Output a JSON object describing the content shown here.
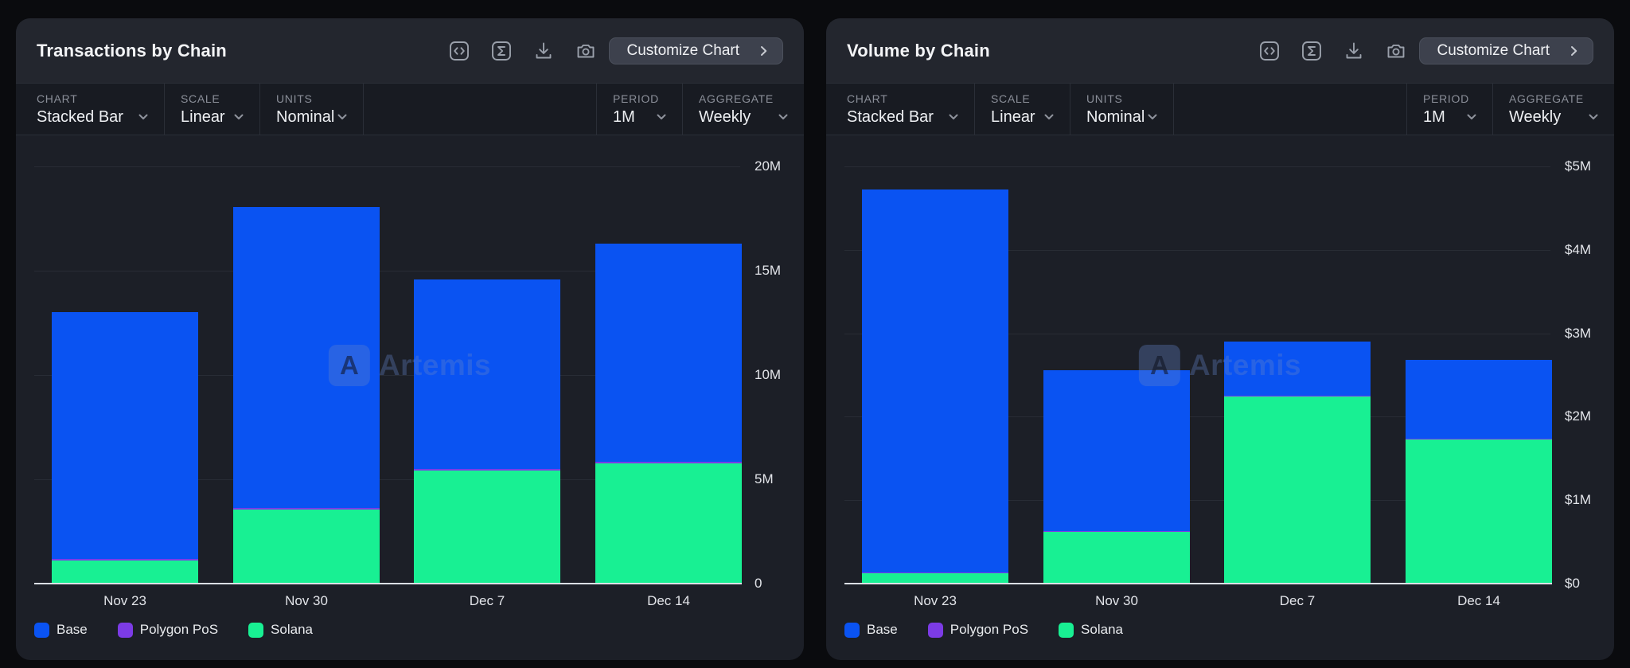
{
  "colors": {
    "Base": "#0a53f2",
    "Polygon PoS": "#7c3be6",
    "Solana": "#18f093",
    "panel_bg": "#1c1f27",
    "header_bg": "#23262e",
    "filter_bg": "#181b22",
    "page_bg": "#0a0b0e",
    "axis_line": "#dce0e6",
    "grid_line": "#282c35"
  },
  "watermark": {
    "text": "Artemis",
    "logo_letter": "A"
  },
  "panels": [
    {
      "title": "Transactions by Chain",
      "toolbar": {
        "icons": [
          "code-icon",
          "sigma-icon",
          "download-icon",
          "camera-icon"
        ],
        "customize_label": "Customize Chart"
      },
      "filters": [
        {
          "label": "CHART",
          "value": "Stacked Bar"
        },
        {
          "label": "SCALE",
          "value": "Linear"
        },
        {
          "label": "UNITS",
          "value": "Nominal"
        },
        {
          "label": "PERIOD",
          "value": "1M"
        },
        {
          "label": "AGGREGATE",
          "value": "Weekly"
        }
      ],
      "chart_data": {
        "type": "bar",
        "stacked": true,
        "title": "Transactions by Chain",
        "units": "transactions (millions)",
        "categories": [
          "Nov 23",
          "Nov 30",
          "Dec 7",
          "Dec 14"
        ],
        "series": [
          {
            "name": "Base",
            "values": [
              11.83,
              14.42,
              9.08,
              10.46
            ]
          },
          {
            "name": "Polygon PoS",
            "values": [
              0.08,
              0.08,
              0.08,
              0.08
            ]
          },
          {
            "name": "Solana",
            "values": [
              1.1,
              3.55,
              5.42,
              5.76
            ]
          }
        ],
        "totals": [
          13.01,
          18.05,
          14.58,
          16.3
        ],
        "stack_order_bottom_up": [
          "Solana",
          "Polygon PoS",
          "Base"
        ],
        "ylim": [
          0,
          20
        ],
        "yticks": [
          {
            "value": 20,
            "label": "20M"
          },
          {
            "value": 15,
            "label": "15M"
          },
          {
            "value": 10,
            "label": "10M"
          },
          {
            "value": 5,
            "label": "5M"
          }
        ],
        "zero_label": "0",
        "grid": true,
        "legend_position": "bottom"
      }
    },
    {
      "title": "Volume by Chain",
      "toolbar": {
        "icons": [
          "code-icon",
          "sigma-icon",
          "download-icon",
          "camera-icon"
        ],
        "customize_label": "Customize Chart"
      },
      "filters": [
        {
          "label": "CHART",
          "value": "Stacked Bar"
        },
        {
          "label": "SCALE",
          "value": "Linear"
        },
        {
          "label": "UNITS",
          "value": "Nominal"
        },
        {
          "label": "PERIOD",
          "value": "1M"
        },
        {
          "label": "AGGREGATE",
          "value": "Weekly"
        }
      ],
      "chart_data": {
        "type": "bar",
        "stacked": true,
        "title": "Volume by Chain",
        "units": "USD (millions)",
        "categories": [
          "Nov 23",
          "Nov 30",
          "Dec 7",
          "Dec 14"
        ],
        "series": [
          {
            "name": "Base",
            "values": [
              4.59,
              1.93,
              0.65,
              0.94
            ]
          },
          {
            "name": "Polygon PoS",
            "values": [
              0.01,
              0.01,
              0.01,
              0.01
            ]
          },
          {
            "name": "Solana",
            "values": [
              0.12,
              0.62,
              2.24,
              1.73
            ]
          }
        ],
        "totals": [
          4.72,
          2.56,
          2.9,
          2.68
        ],
        "stack_order_bottom_up": [
          "Solana",
          "Polygon PoS",
          "Base"
        ],
        "ylim": [
          0,
          5
        ],
        "yticks": [
          {
            "value": 5,
            "label": "$5M"
          },
          {
            "value": 4,
            "label": "$4M"
          },
          {
            "value": 3,
            "label": "$3M"
          },
          {
            "value": 2,
            "label": "$2M"
          },
          {
            "value": 1,
            "label": "$1M"
          }
        ],
        "zero_label": "$0",
        "grid": true,
        "legend_position": "bottom"
      }
    }
  ]
}
